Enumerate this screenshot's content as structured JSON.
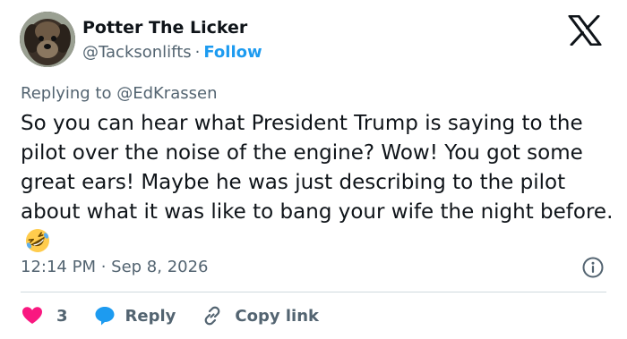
{
  "author": {
    "display_name": "Potter The Licker",
    "handle": "@Tacksonlifts",
    "separator": "·",
    "follow_label": "Follow"
  },
  "logo": "x-logo",
  "reply_context": "Replying to @EdKrassen",
  "tweet": {
    "text": "So you can hear what President Trump is saying to the pilot over the noise of the engine? Wow! You got some great ears! Maybe he was just describing to the pilot about what it was like to bang your wife the night before.",
    "emoji": "rolling-on-floor-laughing"
  },
  "timestamp": "12:14 PM · Sep 8, 2026",
  "actions": {
    "like_count": "3",
    "reply_label": "Reply",
    "copy_label": "Copy link"
  },
  "colors": {
    "accent": "#1d9bf0",
    "like": "#f91880",
    "text": "#0f1419",
    "muted": "#536471"
  }
}
